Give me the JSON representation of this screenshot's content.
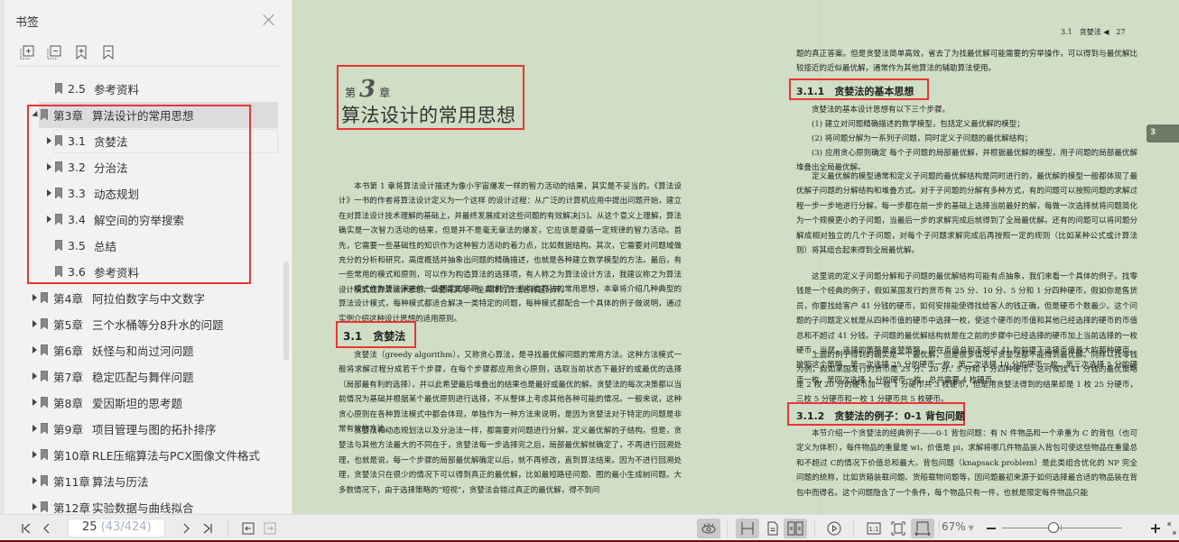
{
  "sidebar": {
    "title": "书签",
    "tools": [
      "expand-all-icon",
      "collapse-all-icon",
      "add-bookmark-icon",
      "remove-bookmark-icon"
    ],
    "items": [
      {
        "num": "2.5",
        "label": "参考资料",
        "level": 2,
        "arrow": "none"
      },
      {
        "num": "第3章",
        "label": "算法设计的常用思想",
        "level": 1,
        "arrow": "down",
        "selected": true
      },
      {
        "num": "3.1",
        "label": "贪婪法",
        "level": 2,
        "arrow": "right",
        "hover": true
      },
      {
        "num": "3.2",
        "label": "分治法",
        "level": 2,
        "arrow": "right"
      },
      {
        "num": "3.3",
        "label": "动态规划",
        "level": 2,
        "arrow": "right"
      },
      {
        "num": "3.4",
        "label": "解空间的穷举搜索",
        "level": 2,
        "arrow": "right"
      },
      {
        "num": "3.5",
        "label": "总结",
        "level": 2,
        "arrow": "none"
      },
      {
        "num": "3.6",
        "label": "参考资料",
        "level": 2,
        "arrow": "none"
      },
      {
        "num": "第4章",
        "label": "阿拉伯数字与中文数字",
        "level": 1,
        "arrow": "right"
      },
      {
        "num": "第5章",
        "label": "三个水桶等分8升水的问题",
        "level": 1,
        "arrow": "right"
      },
      {
        "num": "第6章",
        "label": "妖怪与和尚过河问题",
        "level": 1,
        "arrow": "right"
      },
      {
        "num": "第7章",
        "label": "稳定匹配与舞伴问题",
        "level": 1,
        "arrow": "right"
      },
      {
        "num": "第8章",
        "label": "爱因斯坦的思考题",
        "level": 1,
        "arrow": "right"
      },
      {
        "num": "第9章",
        "label": "项目管理与图的拓扑排序",
        "level": 1,
        "arrow": "right"
      },
      {
        "num": "第10章",
        "label": "RLE压缩算法与PCX图像文件格式",
        "level": 1,
        "arrow": "right"
      },
      {
        "num": "第11章",
        "label": "算法与历法",
        "level": 1,
        "arrow": "right"
      },
      {
        "num": "第12章",
        "label": "实验数据与曲线拟合",
        "level": 1,
        "arrow": "right"
      }
    ]
  },
  "document": {
    "left_page": {
      "chapter_prefix": "第",
      "chapter_number": "3",
      "chapter_suffix": "章",
      "chapter_title": "算法设计的常用思想",
      "intro_p1": "本书第 1 章将算法设计描述为像小宇宙爆发一样的智力活动的结果，其实是不妥当的。《算法设计》一书的作者将算法设计定义为一个这样 的设计过程：从广泛的计算机应用中提出问题开始，建立在对算法设计技术理解的基础上，并最终发展成对这些问题的有效解决[5]。从这个意义上理解，算法确实是一次智力活动的结果，但是并不是毫无章法的爆发，它应该是遵循一定规律的智力活动。首先，它需要一些基础性的知识作为这种智力活动的着力点，比如数据结构。其次，它需要对问题域做充分的分析和研究，高度概括并抽象出问题的精确描述，也就是各种建立数学模型的方法。最后，有一些常用的模式和原则，可以作为构造算法的选择项，有人称之为算法设计方法，我建议称之为算法设计模式或算法设计思想，以便将其与一些具体的算法名称区分开。",
      "intro_p2": "模式作为算法演进的一些固定的思路，提供了一些构造算法的常用思想，本章将介绍几种典型的算法设计模式，每种模式都适合解决一类特定的问题，每种模式都配合一个具体的例子做说明，通过实例介绍这种设计思想的适用原则。",
      "section_heading": "3.1　贪婪法",
      "sec_p1": "贪婪法（greedy algorithm），又称贪心算法，是寻找最优解问题的常用方法。这种方法模式一般将求解过程分成若干个步骤，在每个步骤都应用贪心原则，选取当前状态下最好的或最优的选择（局部最有利的选择），并以此希望最后堆叠出的结果也是最好或最优的解。贪婪法的每次决策都以当前情况为基础并根据某个最优原则进行选择，不从整体上考虑其他各种可能的情况。一般来说，这种贪心原则在各种算法模式中都会体现，单独作为一种方法来说明，是因为贪婪法对于特定的问题是非常有效的方法。",
      "sec_p2": "贪婪法和动态规划法以及分治法一样，都需要对问题进行分解，定义最优解的子结构。但是，贪婪法与其他方法最大的不同在于，贪婪法每一步选择完之后，局部最优解就确定了，不再进行回溯处理，也就是说，每一个步骤的局部最优解确定以后，就不再修改，直到算法结束。因为不进行回溯处理，贪婪法只在很少的情况下可以得到真正的最优解，比如最短路径问题、图的最小生成树问题。大多数情况下，由于选择策略的“短视”，贪婪法会错过真正的最优解，得不到问"
    },
    "right_page": {
      "running_head": "3.1　贪婪法 ◀　27",
      "cont_p": "题的真正答案。但是贪婪法简单高效，省去了为找最优解可能需要的穷举操作，可以得到与最优解比较接近的近似最优解，通常作为其他算法的辅助算法使用。",
      "h_311": "3.1.1　贪婪法的基本思想",
      "p_311_intro": "贪婪法的基本设计思想有以下三个步骤。",
      "step1": "(1) 建立对问题精确描述的数学模型，包括定义最优解的模型；",
      "step2": "(2) 将问题分解为一系列子问题，同时定义子问题的最优解结构；",
      "step3": "(3) 应用贪心原则确定 每个子问题的局部最优解，并根据最优解的模型，用子问题的局部最优解堆叠出全局最优解。",
      "p_311_b": "定义最优解的模型通常和定义子问题的最优解结构是同时进行的，最优解的模型一般都体现了最优解子问题的分解结构和堆叠方式。对于子问题的分解有多种方式，有的问题可以按照问题的求解过程一步一步地进行分解，每一步都在前一步的基础上选择当前最好的解，每做一次选择就将问题简化为一个规模更小的子问题，当最后一步的求解完成后就得到了全局最优解。还有的问题可以将问题分解成相对独立的几个子问题，对每个子问题求解完成后再按照一定的规则（比如某种公式或计算法则）将其组合起来得到全局最优解。",
      "p_311_c": "这里说的定义子问题分解和子问题的最优解结构可能有点抽象，我们来看一个具体的例子。找零钱是一个经典的例子，假如某国发行的货币有 25 分、10 分、5 分和 1 分四种硬币，假如你是售货员，你要找给客户 41 分钱的硬币，如何安排能使得找给客人的钱正确，但是硬币个数最少。这个问题的子问题定义就是从四种币值的硬币中选择一枚，使这个硬币的币值和其他已经选择的硬币的币值总和不超过 41 分钱。子问题的最优解结构就是在之前的步骤中已经选择的硬币加上当前选择的一枚硬币，当然，选择的策略是贪婪策略，即在币值总和不超过 41 的前提下选择币值最大的那种硬币。按照这个策略，第一次选择 25 分的硬币一枚，第二次选择 10 分的硬币一枚，第三次选择 5 分的硬币一枚，第四次选择 1 分的硬币一枚，总共需要 4 枚硬币。",
      "p_311_d": "上面的例子得到的确实是一个最优解，但是很多情况下贪婪法都不能得到最优解。同样以找零钱为例，假如某国发行的货币是 25 分、20 分、5 分和 1 分四种硬币，这时候找 41 分钱的最优策略是 2 枚 20 分的硬币加一枚 1 分硬币共 3 枚硬币，但是用贪婪法得到的结果却是 1 枚 25 分硬币，三枚 5 分硬币和一枚 1 分硬币共 5 枚硬币。",
      "h_312": "3.1.2　贪婪法的例子：0-1 背包问题",
      "p_312": "本节介绍一个贪婪法的经典例子——0-1 背包问题：有 N 件物品和一个承重为 C 的背包（也可定义为体积），每件物品的重量是 wi，价值是 pi，求解将哪几件物品装入背包可使这些物品在重量总和不超过 C的情况下价值总和最大。背包问题（knapsack problem）是此类组合优化的 NP 完全问题的统称，比如货箱装载问题、货船载物问题等，因问题最初来源于如何选择最合适的物品装在背包中而得名。这个问题隐含了一个条件，每个物品只有一件，也就是限定每件物品只能",
      "chapter_tab": "3"
    }
  },
  "bottombar": {
    "page_current": "25",
    "page_total": "(43/424)",
    "zoom": "67%",
    "zoom_fraction": 0.43
  }
}
